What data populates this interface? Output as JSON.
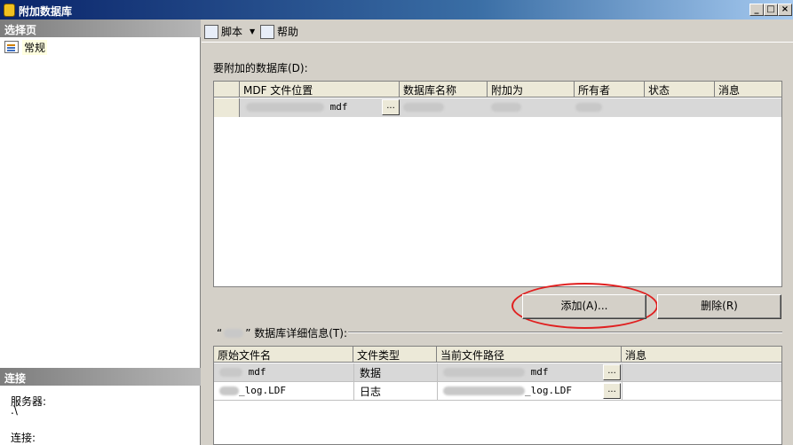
{
  "window": {
    "title": "附加数据库",
    "min": "_",
    "max": "□",
    "close": "×"
  },
  "left": {
    "select_page_header": "选择页",
    "nav_items": [
      {
        "label": "常规"
      }
    ],
    "connection_header": "连接",
    "server_label": "服务器:",
    "server_value": ".\\",
    "connection_label": "连接:"
  },
  "toolbar": {
    "script_label": "脚本",
    "help_label": "帮助"
  },
  "attach": {
    "section_label": "要附加的数据库(D):",
    "columns": [
      "MDF 文件位置",
      "数据库名称",
      "附加为",
      "所有者",
      "状态",
      "消息"
    ],
    "rows": [
      {
        "mdf": "mdf",
        "browse": "..."
      }
    ],
    "add_button": "添加(A)...",
    "remove_button": "删除(R)"
  },
  "details": {
    "section_label_prefix": "“",
    "section_label_suffix": "” 数据库详细信息(T):",
    "columns": [
      "原始文件名",
      "文件类型",
      "当前文件路径",
      "消息"
    ],
    "rows": [
      {
        "name": "mdf",
        "type": "数据",
        "path": "mdf",
        "browse": "..."
      },
      {
        "name": "_log.LDF",
        "type": "日志",
        "path": "_log.LDF",
        "browse": "..."
      }
    ]
  }
}
